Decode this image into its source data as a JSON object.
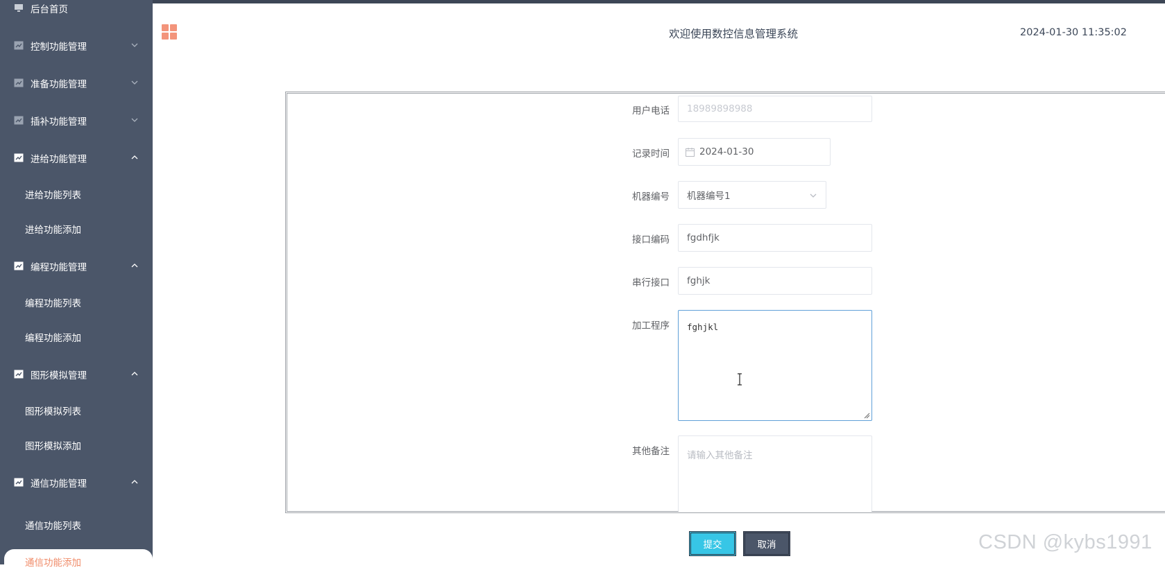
{
  "sidebar": {
    "top_item": "后台首页",
    "menus": [
      {
        "label": "控制功能管理",
        "expanded": false
      },
      {
        "label": "准备功能管理",
        "expanded": false
      },
      {
        "label": "插补功能管理",
        "expanded": false
      },
      {
        "label": "进给功能管理",
        "expanded": true,
        "children": [
          "进给功能列表",
          "进给功能添加"
        ]
      },
      {
        "label": "编程功能管理",
        "expanded": true,
        "children": [
          "编程功能列表",
          "编程功能添加"
        ]
      },
      {
        "label": "图形模拟管理",
        "expanded": true,
        "children": [
          "图形模拟列表",
          "图形模拟添加"
        ]
      },
      {
        "label": "通信功能管理",
        "expanded": true,
        "children": [
          "通信功能列表",
          "通信功能添加"
        ]
      }
    ],
    "active_item": "通信功能添加"
  },
  "header": {
    "title": "欢迎使用数控信息管理系统",
    "datetime": "2024-01-30 11:35:02"
  },
  "form": {
    "phone": {
      "label": "用户电话",
      "value": "18989898988",
      "disabled": true
    },
    "record_time": {
      "label": "记录时间",
      "value": "2024-01-30"
    },
    "machine_no": {
      "label": "机器编号",
      "value": "机器编号1"
    },
    "interface_code": {
      "label": "接口编码",
      "value": "fgdhfjk"
    },
    "serial_port": {
      "label": "串行接口",
      "value": "fghjk"
    },
    "program": {
      "label": "加工程序",
      "value": "fghjkl"
    },
    "remarks": {
      "label": "其他备注",
      "placeholder": "请输入其他备注"
    }
  },
  "buttons": {
    "submit": "提交",
    "cancel": "取消"
  },
  "watermark": "CSDN @kybs1991",
  "colors": {
    "sidebar_bg": "#4b5669",
    "submit_bg": "#37c6e6",
    "cancel_bg": "#4b5669",
    "accent_orange": "#f08c6a",
    "focus_border": "#5fa0d8"
  }
}
